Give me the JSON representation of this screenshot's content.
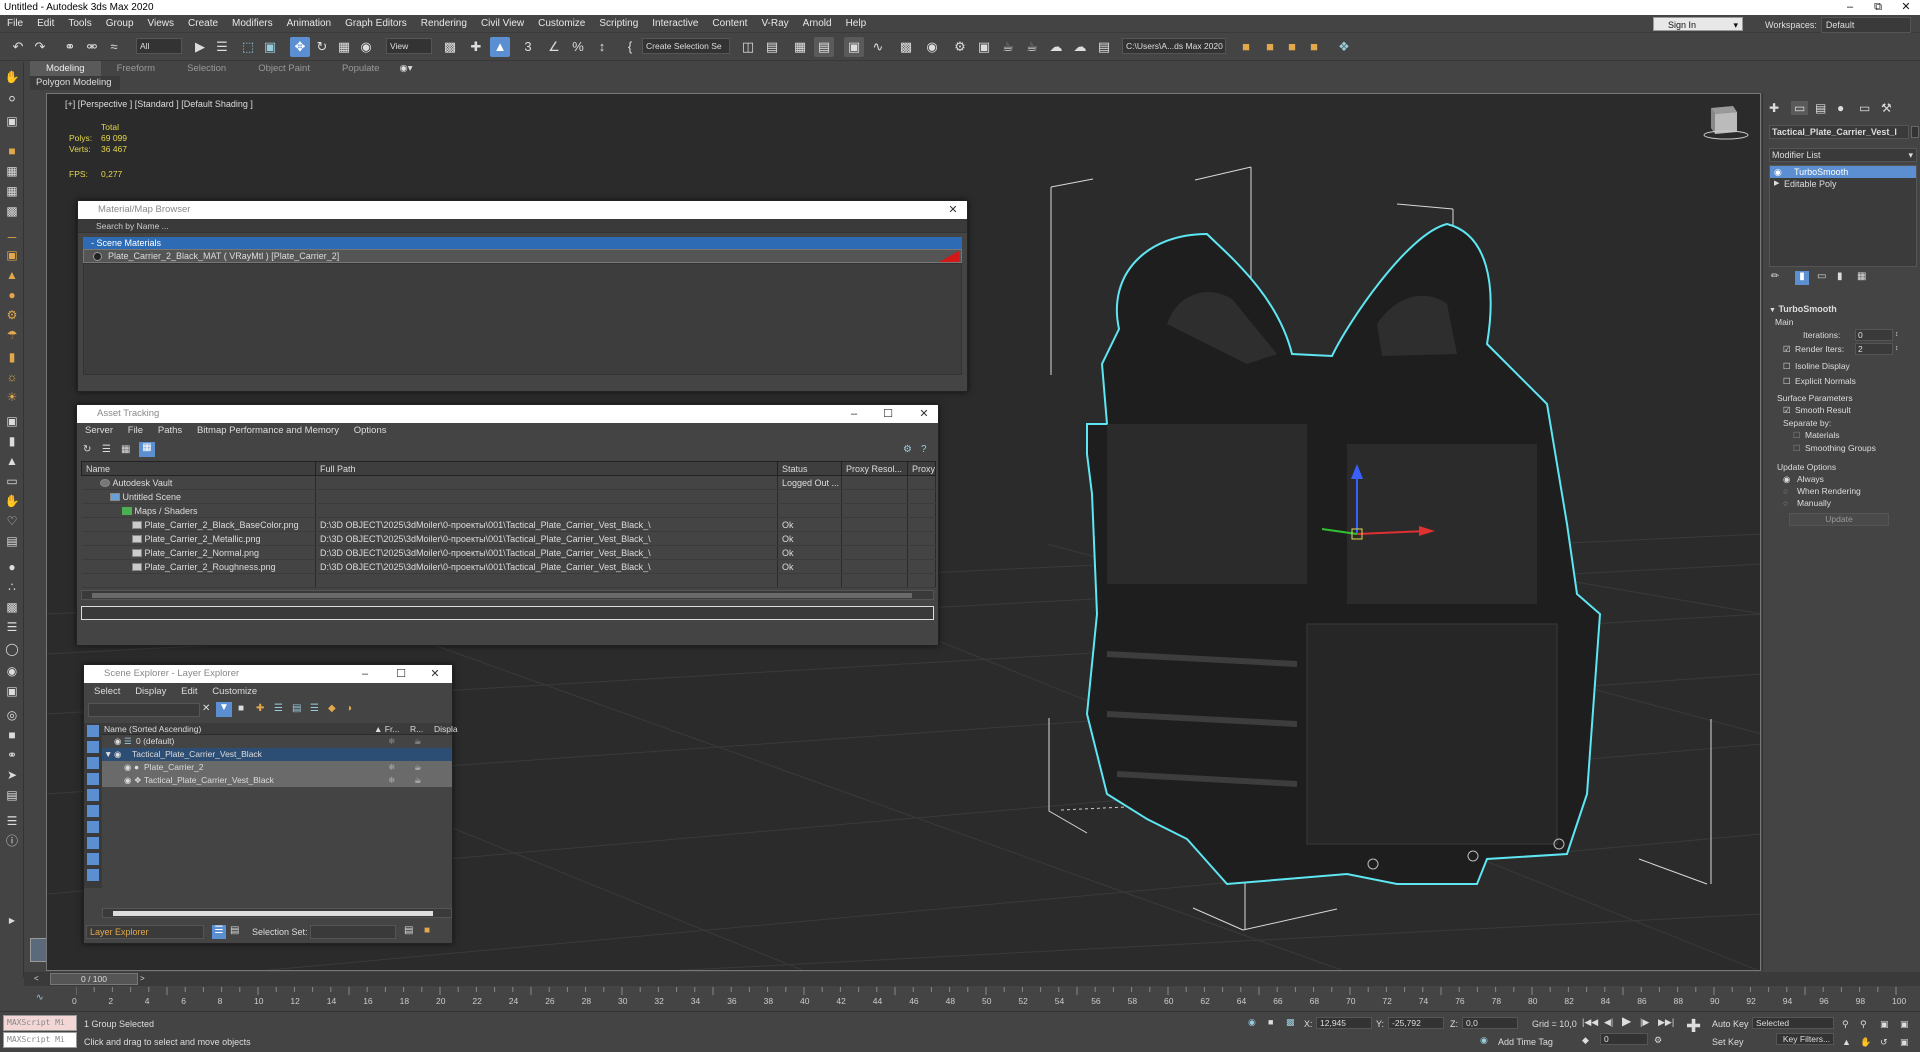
{
  "window": {
    "title": "Untitled - Autodesk 3ds Max 2020"
  },
  "menu": [
    "File",
    "Edit",
    "Tools",
    "Group",
    "Views",
    "Create",
    "Modifiers",
    "Animation",
    "Graph Editors",
    "Rendering",
    "Civil View",
    "Customize",
    "Scripting",
    "Interactive",
    "Content",
    "V-Ray",
    "Arnold",
    "Help"
  ],
  "header": {
    "sign_in": "Sign In",
    "workspaces_label": "Workspaces:",
    "workspaces_value": "Default"
  },
  "toolbar": {
    "filter": "All",
    "view": "View",
    "selection_set": "Create Selection Se",
    "path": "C:\\Users\\A...ds Max 2020"
  },
  "ribbon": {
    "tabs": [
      "Modeling",
      "Freeform",
      "Selection",
      "Object Paint",
      "Populate"
    ],
    "active": "Modeling",
    "sub": "Polygon Modeling"
  },
  "viewport": {
    "label": "[+] [Perspective ] [Standard ] [Default Shading ]",
    "stats": {
      "total": "Total",
      "polys_label": "Polys:",
      "polys": "69 099",
      "verts_label": "Verts:",
      "verts": "36 467",
      "fps_label": "FPS:",
      "fps": "0,277"
    }
  },
  "material_browser": {
    "title": "Material/Map Browser",
    "search_placeholder": "Search by Name ...",
    "section": "- Scene Materials",
    "item": "Plate_Carrier_2_Black_MAT  ( VRayMtl )  [Plate_Carrier_2]"
  },
  "asset_tracking": {
    "title": "Asset Tracking",
    "menu": [
      "Server",
      "File",
      "Paths",
      "Bitmap Performance and Memory",
      "Options"
    ],
    "columns": [
      "Name",
      "Full Path",
      "Status",
      "Proxy Resol...",
      "Proxy S"
    ],
    "rows": [
      {
        "name": "Autodesk Vault",
        "path": "",
        "status": "Logged Out ..."
      },
      {
        "name": "Untitled Scene",
        "path": "",
        "status": ""
      },
      {
        "name": "Maps / Shaders",
        "path": "",
        "status": ""
      },
      {
        "name": "Plate_Carrier_2_Black_BaseColor.png",
        "path": "D:\\3D OBJECT\\2025\\3dMoiler\\0-проекты\\001\\Tactical_Plate_Carrier_Vest_Black_\\",
        "status": "Ok"
      },
      {
        "name": "Plate_Carrier_2_Metallic.png",
        "path": "D:\\3D OBJECT\\2025\\3dMoiler\\0-проекты\\001\\Tactical_Plate_Carrier_Vest_Black_\\",
        "status": "Ok"
      },
      {
        "name": "Plate_Carrier_2_Normal.png",
        "path": "D:\\3D OBJECT\\2025\\3dMoiler\\0-проекты\\001\\Tactical_Plate_Carrier_Vest_Black_\\",
        "status": "Ok"
      },
      {
        "name": "Plate_Carrier_2_Roughness.png",
        "path": "D:\\3D OBJECT\\2025\\3dMoiler\\0-проекты\\001\\Tactical_Plate_Carrier_Vest_Black_\\",
        "status": "Ok"
      }
    ]
  },
  "scene_explorer": {
    "title": "Scene Explorer - Layer Explorer",
    "menu": [
      "Select",
      "Display",
      "Edit",
      "Customize"
    ],
    "col_name": "Name (Sorted Ascending)",
    "col_fr": "▲ Fr...",
    "col_r": "R...",
    "col_disp": "Displa",
    "rows": [
      "0 (default)",
      "Tactical_Plate_Carrier_Vest_Black",
      "Plate_Carrier_2",
      "Tactical_Plate_Carrier_Vest_Black"
    ],
    "footer_layer": "Layer Explorer",
    "footer_selset": "Selection Set:"
  },
  "command_panel": {
    "object_name": "Tactical_Plate_Carrier_Vest_l",
    "modifier_list": "Modifier List",
    "stack": [
      "TurboSmooth",
      "Editable Poly"
    ],
    "rollout": "TurboSmooth",
    "main": "Main",
    "iterations_label": "Iterations:",
    "iterations": "0",
    "render_iters_label": "Render Iters:",
    "render_iters": "2",
    "isoline": "Isoline Display",
    "explicit": "Explicit Normals",
    "surface": "Surface Parameters",
    "smooth_result": "Smooth Result",
    "separate_by": "Separate by:",
    "materials": "Materials",
    "smoothing_groups": "Smoothing Groups",
    "update_options": "Update Options",
    "always": "Always",
    "when_rendering": "When Rendering",
    "manually": "Manually",
    "update": "Update"
  },
  "timeline": {
    "frame": "0 / 100",
    "ticks": [
      "0",
      "2",
      "4",
      "6",
      "8",
      "10",
      "12",
      "14",
      "16",
      "18",
      "20",
      "22",
      "24",
      "26",
      "28",
      "30",
      "32",
      "34",
      "36",
      "38",
      "40",
      "42",
      "44",
      "46",
      "48",
      "50",
      "52",
      "54",
      "56",
      "58",
      "60",
      "62",
      "64",
      "66",
      "68",
      "70",
      "72",
      "74",
      "76",
      "78",
      "80",
      "82",
      "84",
      "86",
      "88",
      "90",
      "92",
      "94",
      "96",
      "98",
      "100"
    ]
  },
  "status": {
    "maxscript": "MAXScript Mi",
    "selected": "1 Group Selected",
    "prompt": "Click and drag to select and move objects",
    "x_label": "X:",
    "x": "12,945",
    "y_label": "Y:",
    "y": "-25,792",
    "z_label": "Z:",
    "z": "0,0",
    "grid": "Grid = 10,0",
    "add_time_tag": "Add Time Tag",
    "auto_key": "Auto Key",
    "set_key": "Set Key",
    "selected_dd": "Selected",
    "key_filters": "Key Filters...",
    "frame_field": "0"
  }
}
